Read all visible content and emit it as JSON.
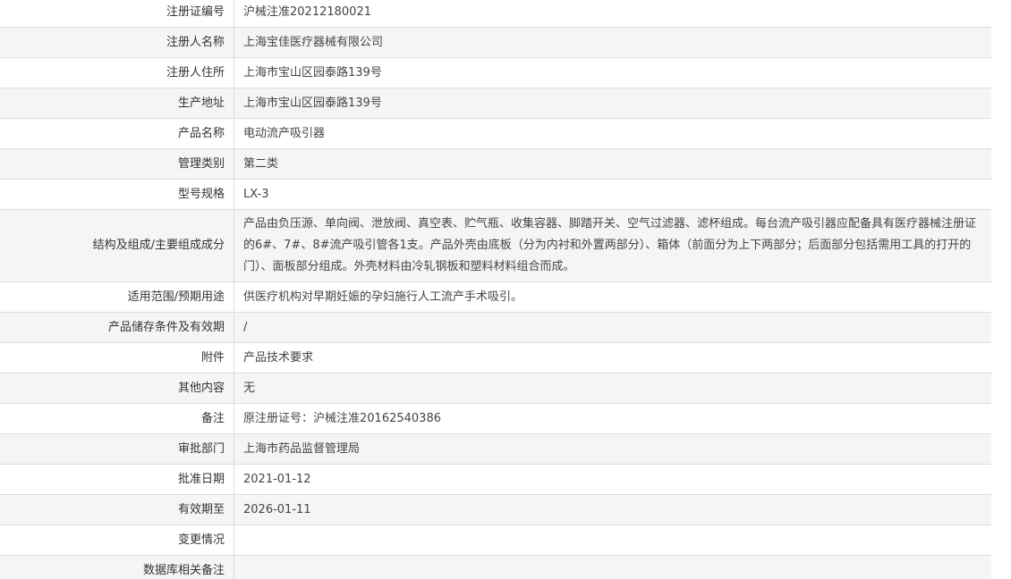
{
  "rows": [
    {
      "label": "注册证编号",
      "value": "沪械注准20212180021"
    },
    {
      "label": "注册人名称",
      "value": "上海宝佳医疗器械有限公司"
    },
    {
      "label": "注册人住所",
      "value": "上海市宝山区园泰路139号"
    },
    {
      "label": "生产地址",
      "value": "上海市宝山区园泰路139号"
    },
    {
      "label": "产品名称",
      "value": "电动流产吸引器"
    },
    {
      "label": "管理类别",
      "value": "第二类"
    },
    {
      "label": "型号规格",
      "value": "LX-3"
    },
    {
      "label": "结构及组成/主要组成成分",
      "value": "产品由负压源、单向阀、泄放阀、真空表、贮气瓶、收集容器、脚踏开关、空气过滤器、滤杯组成。每台流产吸引器应配备具有医疗器械注册证的6#、7#、8#流产吸引管各1支。产品外壳由底板（分为内衬和外置两部分）、箱体（前面分为上下两部分；后面部分包括需用工具的打开的门）、面板部分组成。外壳材料由冷轧钢板和塑料材料组合而成。"
    },
    {
      "label": "适用范围/预期用途",
      "value": "供医疗机构对早期妊娠的孕妇施行人工流产手术吸引。"
    },
    {
      "label": "产品储存条件及有效期",
      "value": "/"
    },
    {
      "label": "附件",
      "value": "产品技术要求"
    },
    {
      "label": "其他内容",
      "value": "无"
    },
    {
      "label": "备注",
      "value": "原注册证号：沪械注准20162540386"
    },
    {
      "label": "审批部门",
      "value": "上海市药品监督管理局"
    },
    {
      "label": "批准日期",
      "value": "2021-01-12"
    },
    {
      "label": "有效期至",
      "value": "2026-01-11"
    },
    {
      "label": "变更情况",
      "value": ""
    },
    {
      "label": "数据库相关备注",
      "value": ""
    }
  ]
}
